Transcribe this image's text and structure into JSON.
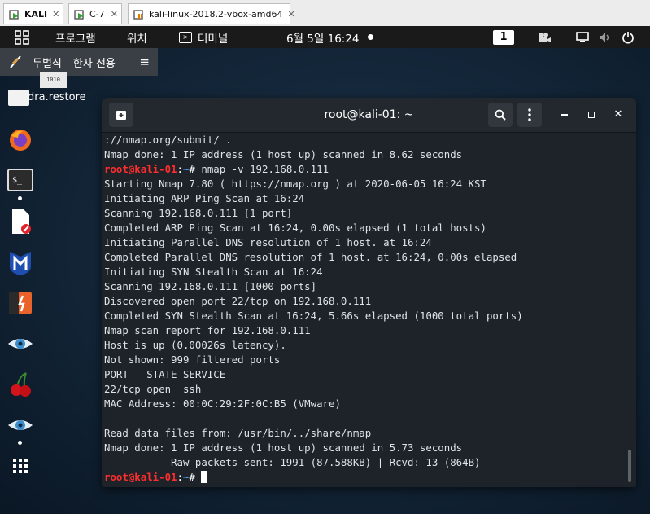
{
  "host_tabs": [
    {
      "label": "KALI",
      "active": true
    },
    {
      "label": "C-7",
      "active": false
    },
    {
      "label": "kali-linux-2018.2-vbox-amd64",
      "active": false
    }
  ],
  "panel": {
    "apps_label": "프로그램",
    "places_label": "위치",
    "terminal_label": "터미널",
    "clock": "6월 5일 16:24",
    "workspace": "1"
  },
  "ime": {
    "engine": "두벌식",
    "mode": "한자 전용"
  },
  "desktop": {
    "file_label": "dra.restore",
    "file_icon_text": "1010"
  },
  "terminal": {
    "title": "root@kali-01: ~",
    "prompt": {
      "user": "root@kali-01",
      "sep": ":",
      "path": "~",
      "sym": "# "
    },
    "lines": [
      {
        "kind": "text",
        "text": "://nmap.org/submit/ ."
      },
      {
        "kind": "text",
        "text": "Nmap done: 1 IP address (1 host up) scanned in 8.62 seconds"
      },
      {
        "kind": "prompt",
        "text": "nmap -v 192.168.0.111"
      },
      {
        "kind": "text",
        "text": "Starting Nmap 7.80 ( https://nmap.org ) at 2020-06-05 16:24 KST"
      },
      {
        "kind": "text",
        "text": "Initiating ARP Ping Scan at 16:24"
      },
      {
        "kind": "text",
        "text": "Scanning 192.168.0.111 [1 port]"
      },
      {
        "kind": "text",
        "text": "Completed ARP Ping Scan at 16:24, 0.00s elapsed (1 total hosts)"
      },
      {
        "kind": "text",
        "text": "Initiating Parallel DNS resolution of 1 host. at 16:24"
      },
      {
        "kind": "text",
        "text": "Completed Parallel DNS resolution of 1 host. at 16:24, 0.00s elapsed"
      },
      {
        "kind": "text",
        "text": "Initiating SYN Stealth Scan at 16:24"
      },
      {
        "kind": "text",
        "text": "Scanning 192.168.0.111 [1000 ports]"
      },
      {
        "kind": "text",
        "text": "Discovered open port 22/tcp on 192.168.0.111"
      },
      {
        "kind": "text",
        "text": "Completed SYN Stealth Scan at 16:24, 5.66s elapsed (1000 total ports)"
      },
      {
        "kind": "text",
        "text": "Nmap scan report for 192.168.0.111"
      },
      {
        "kind": "text",
        "text": "Host is up (0.00026s latency)."
      },
      {
        "kind": "text",
        "text": "Not shown: 999 filtered ports"
      },
      {
        "kind": "text",
        "text": "PORT   STATE SERVICE"
      },
      {
        "kind": "text",
        "text": "22/tcp open  ssh"
      },
      {
        "kind": "text",
        "text": "MAC Address: 00:0C:29:2F:0C:B5 (VMware)"
      },
      {
        "kind": "text",
        "text": ""
      },
      {
        "kind": "text",
        "text": "Read data files from: /usr/bin/../share/nmap"
      },
      {
        "kind": "text",
        "text": "Nmap done: 1 IP address (1 host up) scanned in 5.73 seconds"
      },
      {
        "kind": "text",
        "text": "           Raw packets sent: 1991 (87.588KB) | Rcvd: 13 (864B)"
      },
      {
        "kind": "cursor",
        "text": ""
      }
    ]
  }
}
